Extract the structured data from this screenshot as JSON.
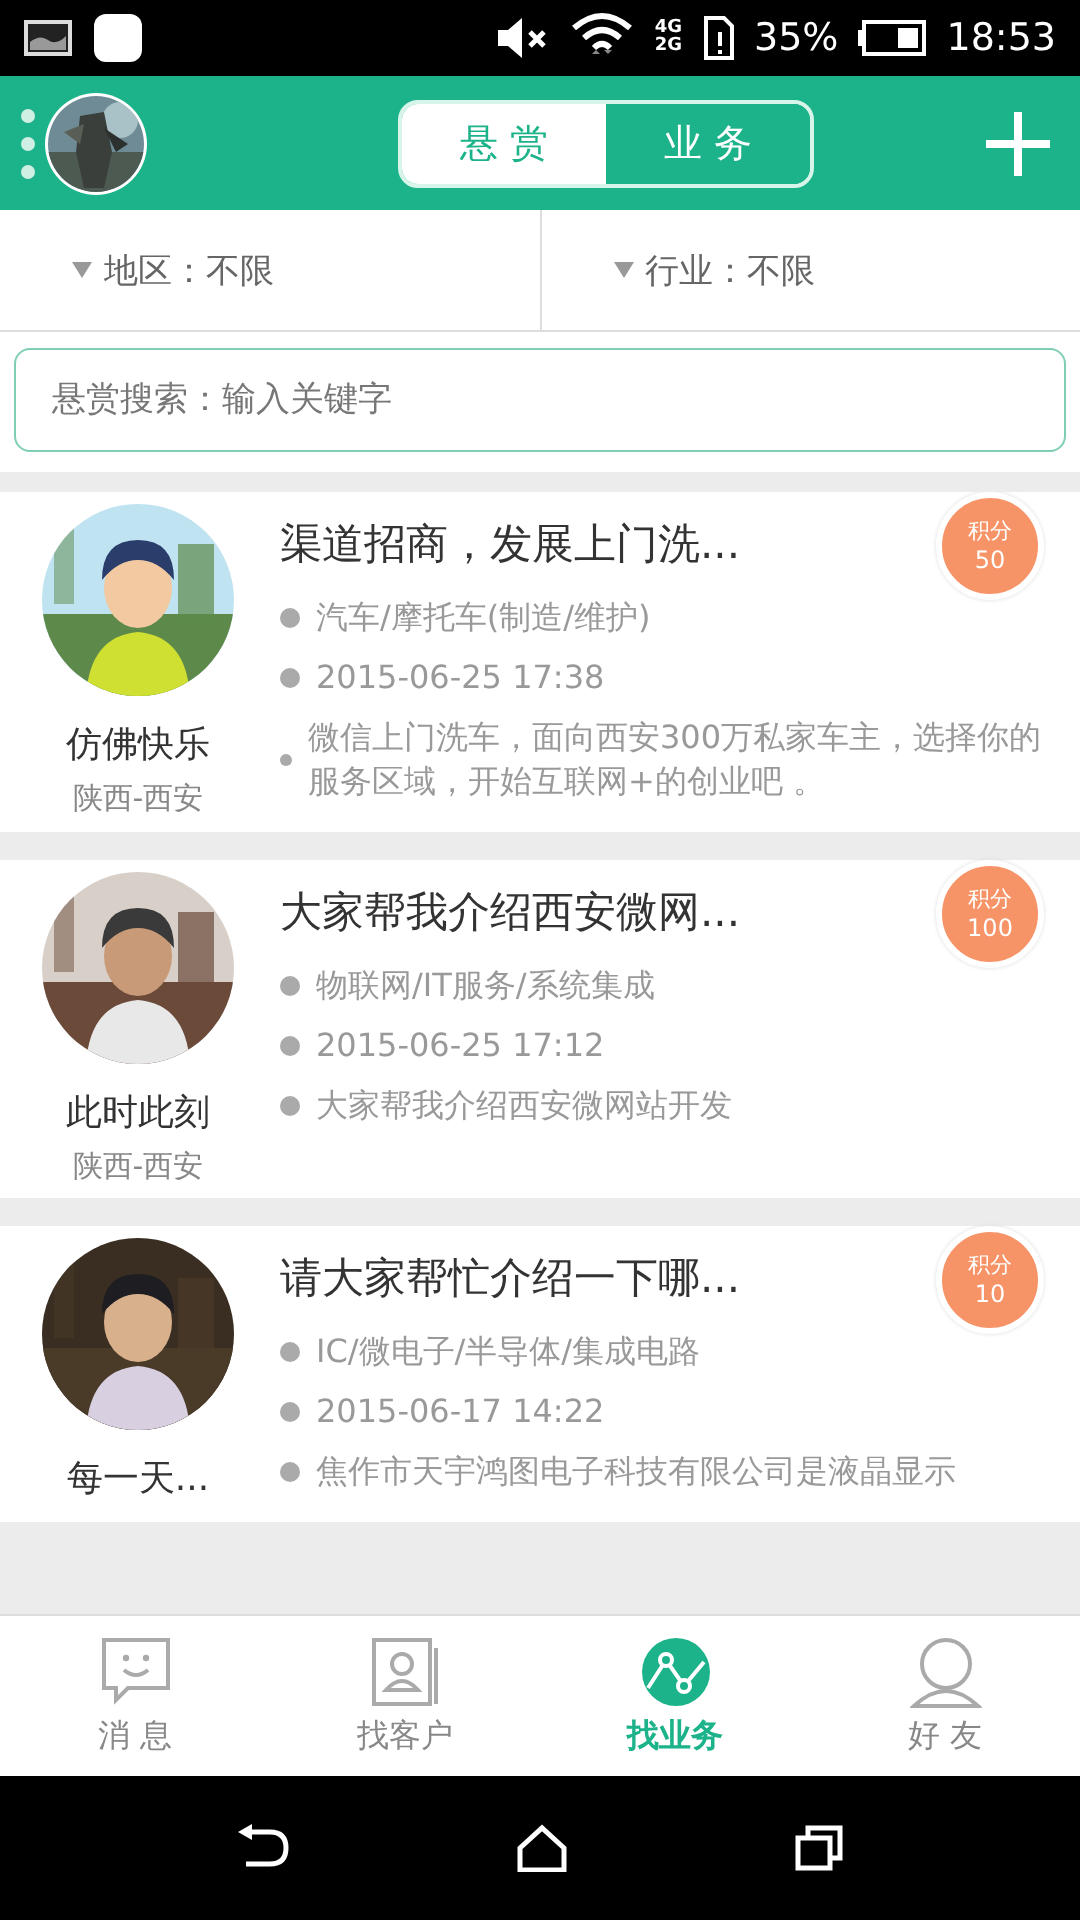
{
  "status_bar": {
    "network": [
      "4G",
      "2G"
    ],
    "battery": "35%",
    "time": "18:53"
  },
  "header": {
    "tabs": [
      {
        "label": "悬 赏",
        "selected": true
      },
      {
        "label": "业 务",
        "selected": false
      }
    ]
  },
  "filters": [
    {
      "label": "地区：不限"
    },
    {
      "label": "行业：不限"
    }
  ],
  "search": {
    "placeholder": "悬赏搜索：输入关键字"
  },
  "posts": [
    {
      "title": "渠道招商，发展上门洗...",
      "name": "仿佛快乐",
      "location": "陕西-西安",
      "badge_label": "积分",
      "points": "50",
      "industry": "汽车/摩托车(制造/维护)",
      "time": "2015-06-25 17:38",
      "description": "微信上门洗车，面向西安300万私家车主，选择你的服务区域，开始互联网+的创业吧 。"
    },
    {
      "title": "大家帮我介绍西安微网...",
      "name": "此时此刻",
      "location": "陕西-西安",
      "badge_label": "积分",
      "points": "100",
      "industry": "物联网/IT服务/系统集成",
      "time": "2015-06-25 17:12",
      "description": "大家帮我介绍西安微网站开发"
    },
    {
      "title": "请大家帮忙介绍一下哪...",
      "name": "每一天...",
      "badge_label": "积分",
      "points": "10",
      "industry": "IC/微电子/半导体/集成电路",
      "time": "2015-06-17 14:22",
      "description": "焦作市天宇鸿图电子科技有限公司是液晶显示"
    }
  ],
  "bottom_nav": [
    {
      "label": "消 息",
      "selected": false
    },
    {
      "label": "找客户",
      "selected": false
    },
    {
      "label": "找业务",
      "selected": true
    },
    {
      "label": "好 友",
      "selected": false
    }
  ]
}
